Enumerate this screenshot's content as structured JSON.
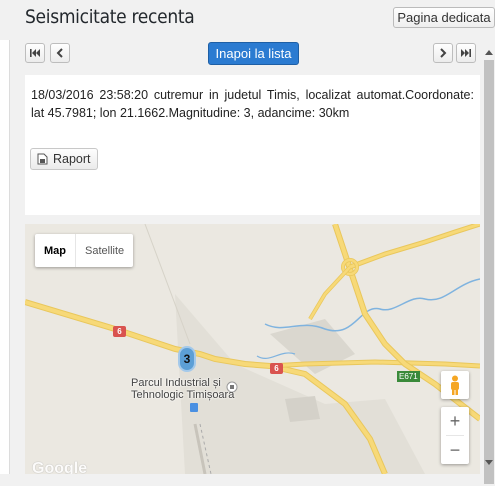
{
  "page": {
    "title": "Seismicitate recenta"
  },
  "header": {
    "dedicated_page_label": "Pagina dedicata"
  },
  "nav": {
    "first_icon": "first-page-icon",
    "prev_icon": "prev-page-icon",
    "back_label": "Inapoi la lista",
    "next_icon": "next-page-icon",
    "last_icon": "last-page-icon"
  },
  "event": {
    "description": "18/03/2016 23:58:20 cutremur in judetul Timis, localizat automat.Coordonate: lat 45.7981; lon 21.1662.Magnitudine: 3, adancime: 30km",
    "report_label": "Raport"
  },
  "map": {
    "type_map": "Map",
    "type_satellite": "Satellite",
    "cluster_count": "3",
    "poi_name_line1": "Parcul Industrial și",
    "poi_name_line2": "Tehnologic Timișoara",
    "route_shield_1": "6",
    "route_shield_2": "6",
    "route_e671": "E671",
    "zoom_in": "+",
    "zoom_out": "−",
    "attribution": "Google",
    "colors": {
      "road": "#f5d36a",
      "river": "#7fb3df",
      "land": "#ebe8e1"
    }
  }
}
